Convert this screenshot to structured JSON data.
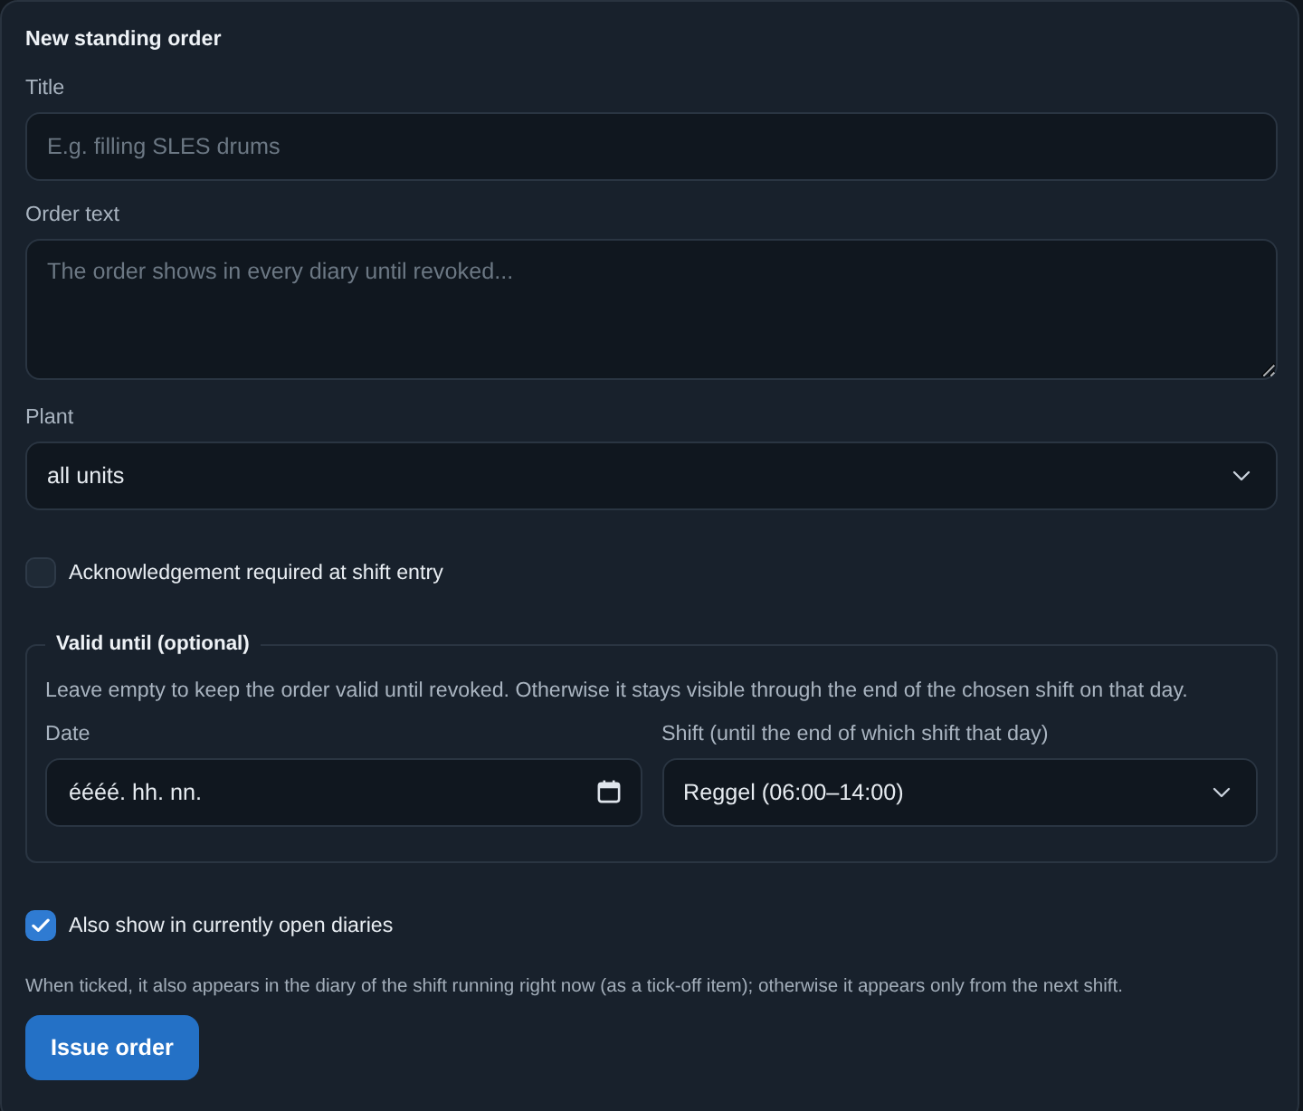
{
  "form": {
    "title": "New standing order",
    "fields": [
      {
        "kind": "text",
        "label": "Title",
        "placeholder": "E.g. filling SLES drums"
      },
      {
        "kind": "textarea",
        "label": "Order text",
        "placeholder": "The order shows in every diary until revoked..."
      },
      {
        "kind": "select",
        "label": "Plant",
        "value": "all units"
      }
    ],
    "acknowledgement": {
      "label": "Acknowledgement required at shift entry",
      "checked": false
    },
    "validity": {
      "legend": "Valid until (optional)",
      "description": "Leave empty to keep the order valid until revoked. Otherwise it stays visible through the end of the chosen shift on that day.",
      "fields": [
        {
          "kind": "date",
          "label": "Date",
          "placeholder": "éééé. hh. nn."
        },
        {
          "kind": "select",
          "label": "Shift (until the end of which shift that day)",
          "value": "Reggel (06:00–14:00)"
        }
      ]
    },
    "show_in_open": {
      "label": "Also show in currently open diaries",
      "checked": true
    },
    "help": "When ticked, it also appears in the diary of the shift running right now (as a tick-off item); otherwise it appears only from the next shift.",
    "submit": "Issue order"
  }
}
